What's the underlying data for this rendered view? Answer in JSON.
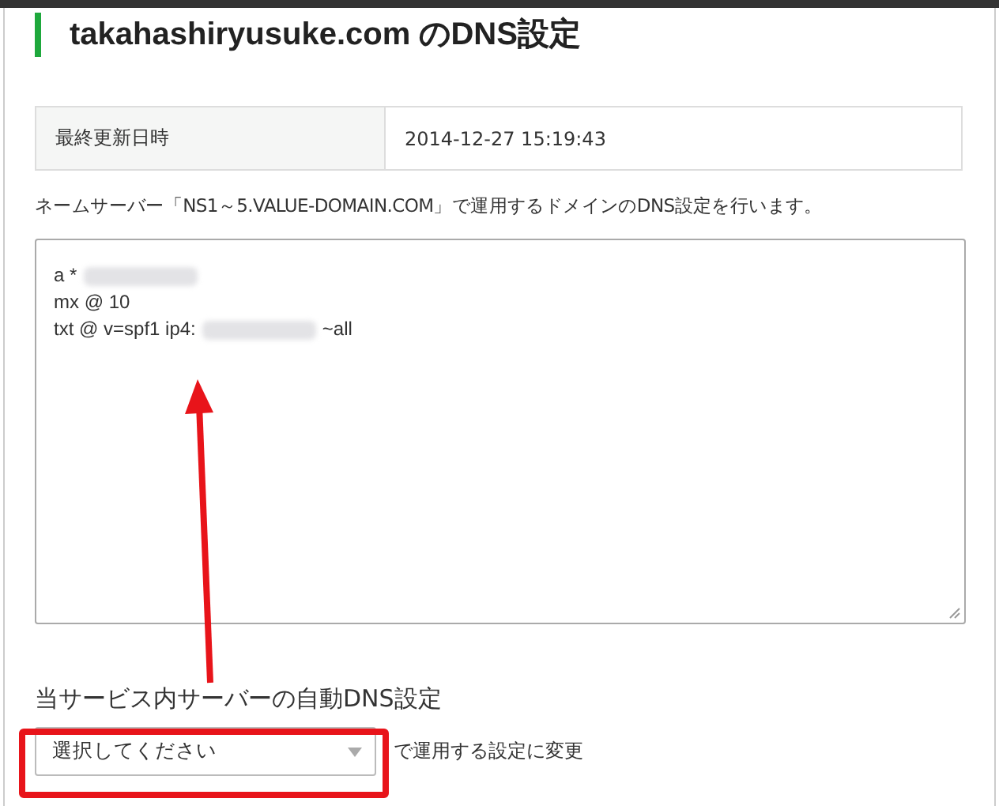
{
  "title": "takahashiryusuke.com のDNS設定",
  "info_table": [
    {
      "label": "最終更新日時",
      "value": "2014-12-27 15:19:43"
    }
  ],
  "description": "ネームサーバー「NS1～5.VALUE-DOMAIN.COM」で運用するドメインのDNS設定を行います。",
  "records_editor": {
    "lines": [
      [
        {
          "kind": "text",
          "text": "a *"
        },
        {
          "kind": "redacted"
        }
      ],
      [
        {
          "kind": "text",
          "text": "mx @ 10"
        }
      ],
      [
        {
          "kind": "text",
          "text": "txt @ v=spf1 ip4:"
        },
        {
          "kind": "redacted"
        },
        {
          "kind": "text",
          "text": "~all"
        }
      ]
    ]
  },
  "auto_dns": {
    "heading": "当サービス内サーバーの自動DNS設定",
    "select": {
      "value": "選択してください"
    },
    "suffix": "で運用する設定に変更"
  },
  "annotations": {
    "arrow": true,
    "highlight_frame": true
  }
}
